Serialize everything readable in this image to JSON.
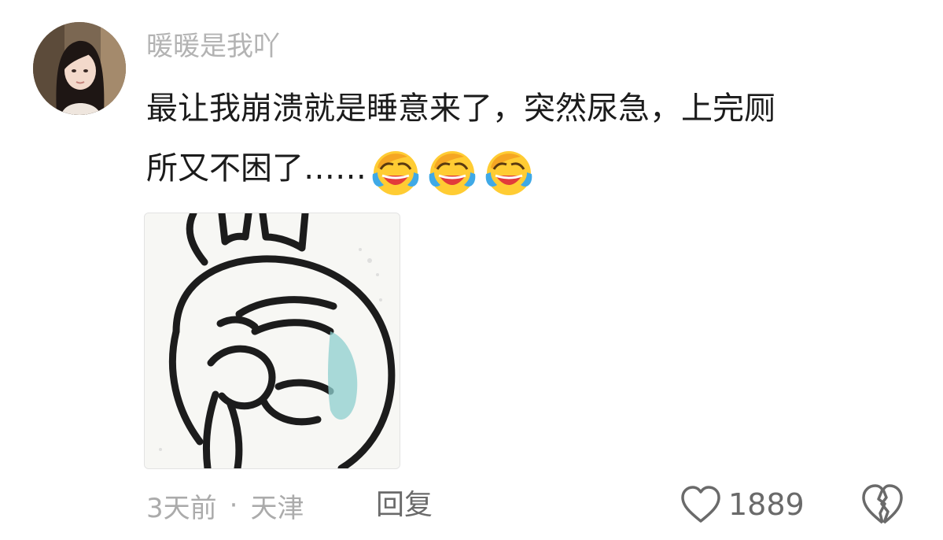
{
  "comment": {
    "username": "暖暖是我吖",
    "text_line1": "最让我崩溃就是睡意来了，突然尿急，上完厕",
    "text_line2": "所又不困了……",
    "emojis": [
      "laughing-crying-emoji",
      "laughing-crying-emoji",
      "laughing-crying-emoji"
    ],
    "meta": {
      "time": "3天前",
      "separator": "·",
      "location": "天津",
      "reply_label": "回复"
    },
    "likes": {
      "count": "1889"
    }
  },
  "colors": {
    "username": "#b3b3b3",
    "text": "#1b1b1b",
    "meta": "#ababab",
    "action": "#6a6a6a",
    "emoji_yellow": "#ffcc33",
    "tears": "#3fa9e6"
  }
}
